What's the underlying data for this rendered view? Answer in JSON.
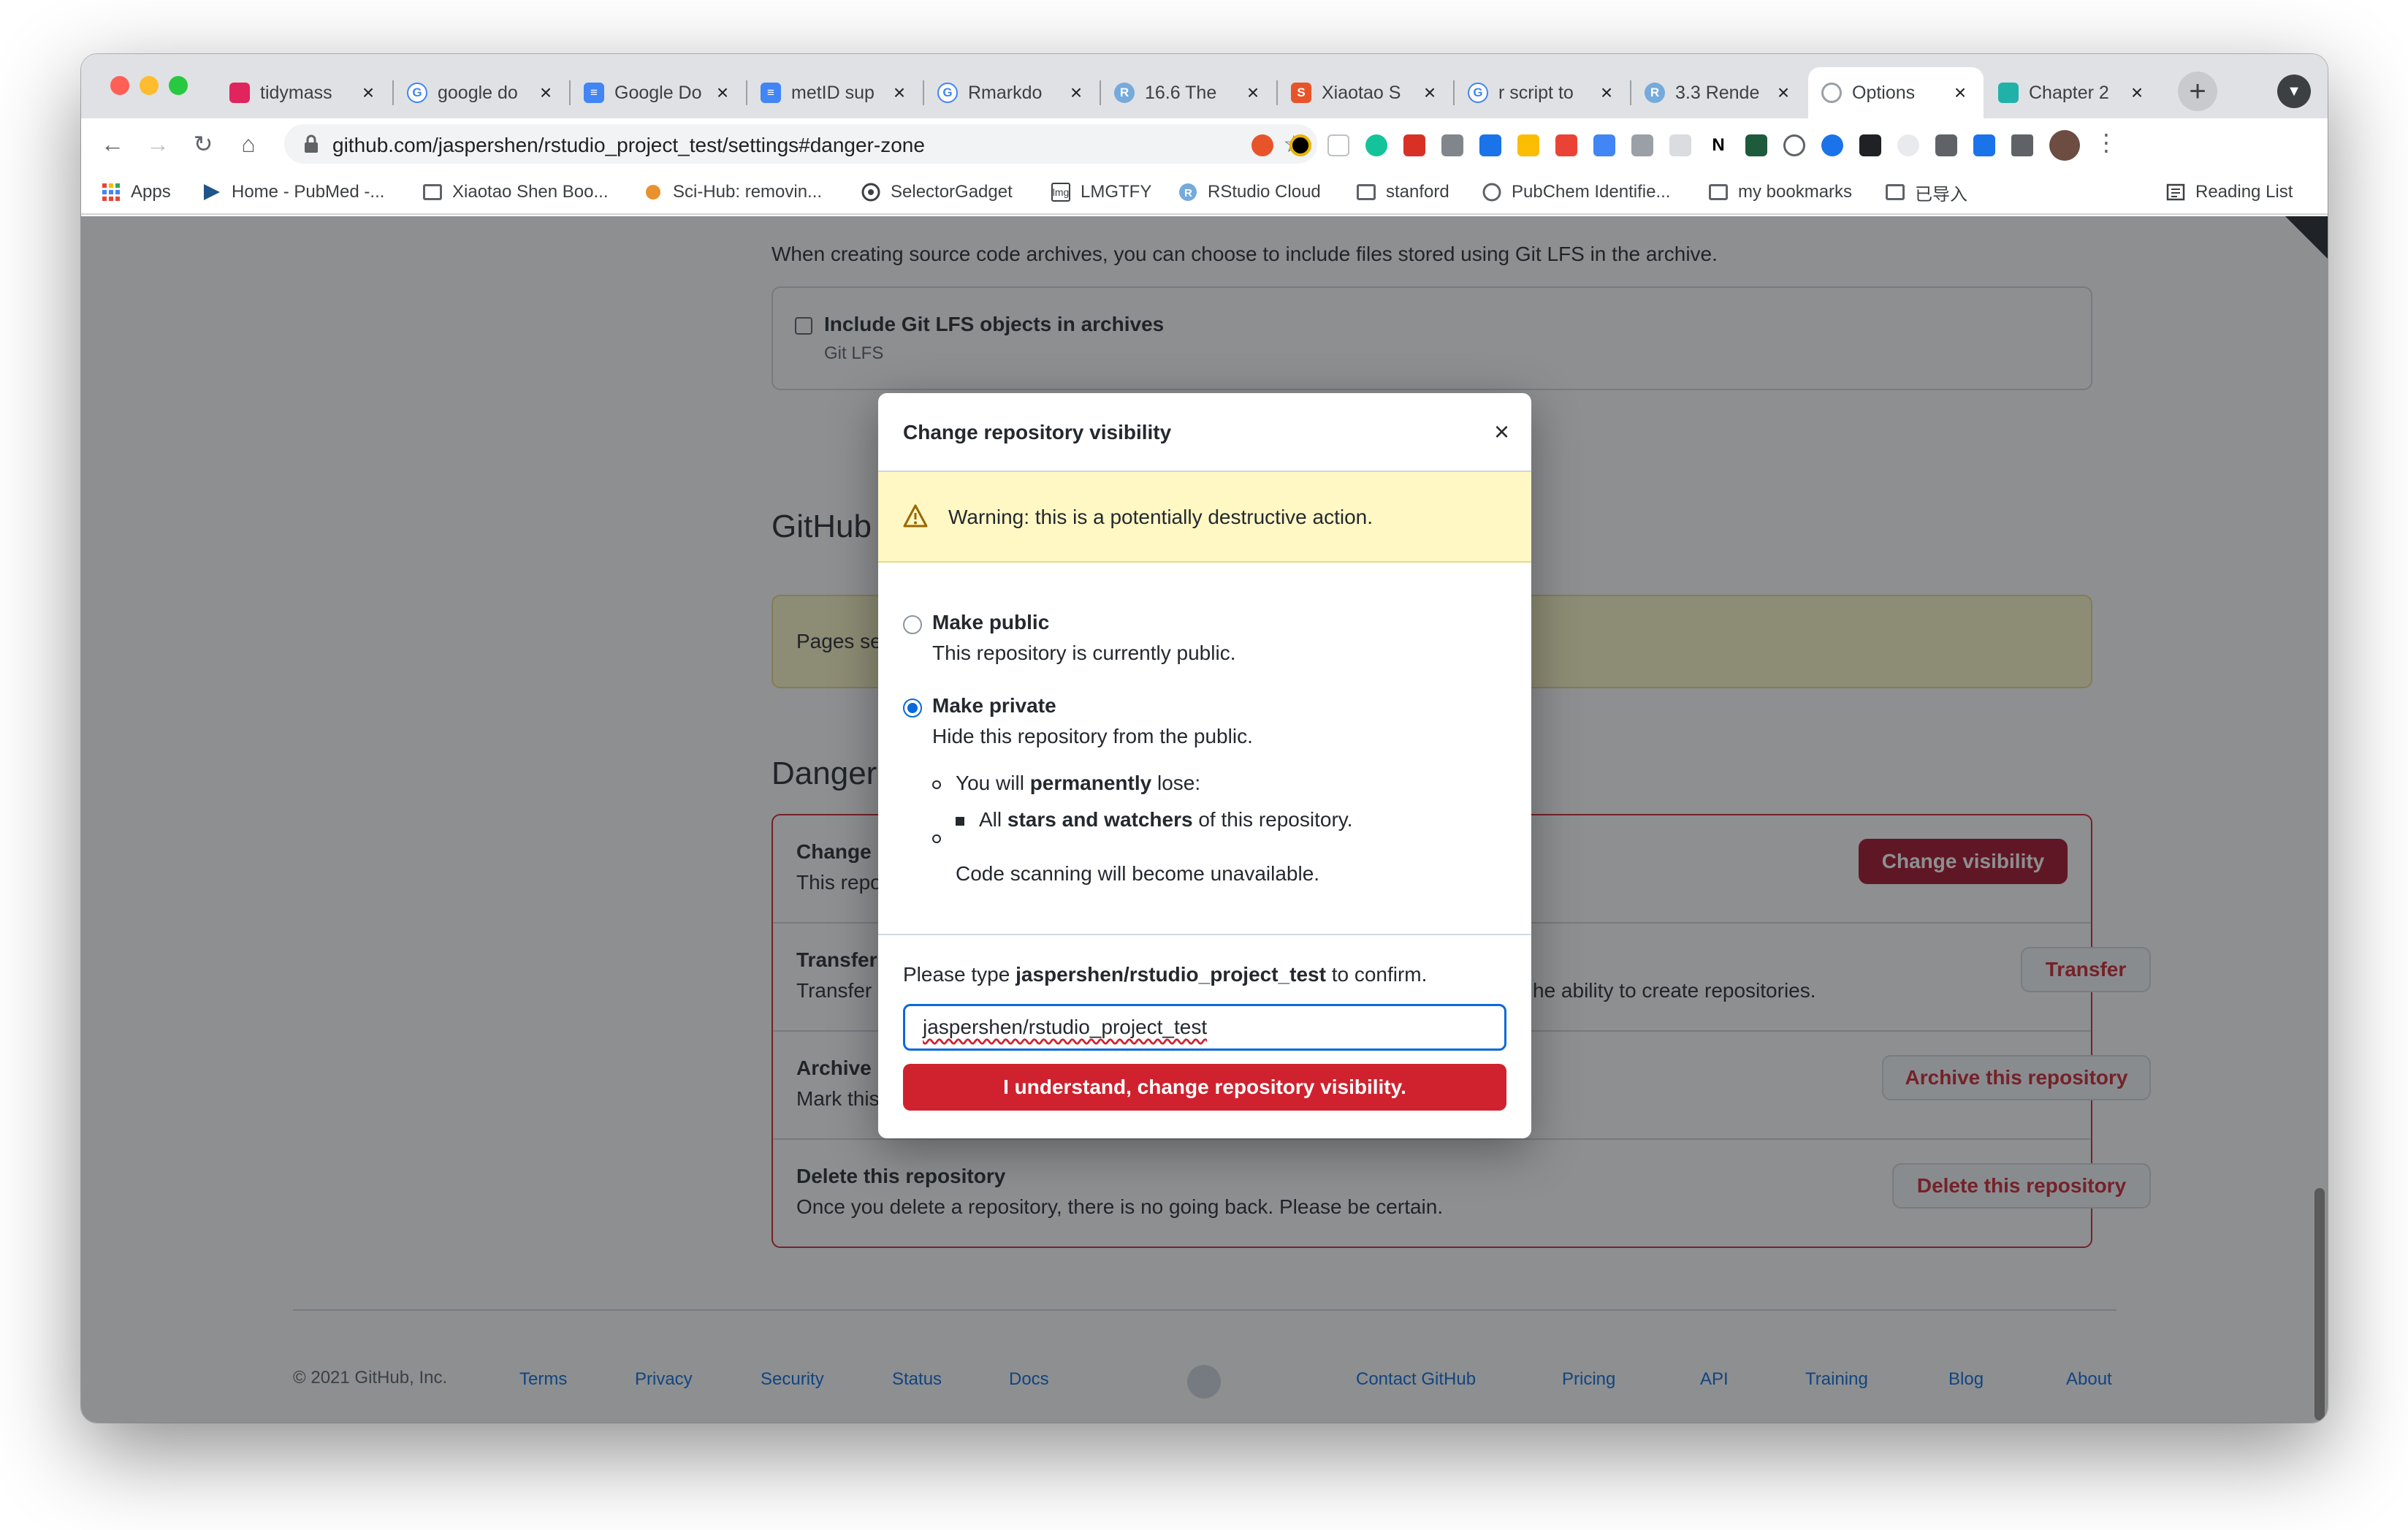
{
  "browser": {
    "tabs": [
      {
        "title": "tidymass",
        "color": "#e0245e"
      },
      {
        "title": "google do",
        "color": "#4285f4"
      },
      {
        "title": "Google Do",
        "color": "#4285f4"
      },
      {
        "title": "metID sup",
        "color": "#4285f4"
      },
      {
        "title": "Rmarkdo",
        "color": "#4285f4"
      },
      {
        "title": "16.6 The",
        "color": "#75aadb"
      },
      {
        "title": "Xiaotao S",
        "color": "#e8542a"
      },
      {
        "title": "r script to",
        "color": "#4285f4"
      },
      {
        "title": "3.3 Rende",
        "color": "#75aadb"
      },
      {
        "title": "Options",
        "color": "#24292f"
      },
      {
        "title": "Chapter 2",
        "color": "#20b2aa"
      }
    ],
    "active_tab_index": 9,
    "url": "github.com/jaspershen/rstudio_project_test/settings#danger-zone",
    "bookmarks": [
      {
        "label": "Apps",
        "icon": "apps-grid-icon"
      },
      {
        "label": "Home - PubMed -...",
        "icon": "pubmed-icon"
      },
      {
        "label": "Xiaotao Shen Boo...",
        "icon": "folder-icon"
      },
      {
        "label": "Sci-Hub: removin...",
        "icon": "scihub-icon"
      },
      {
        "label": "SelectorGadget",
        "icon": "selectorgadget-icon"
      },
      {
        "label": "LMGTFY",
        "icon": "lmgtfy-icon"
      },
      {
        "label": "RStudio Cloud",
        "icon": "rstudio-icon"
      },
      {
        "label": "stanford",
        "icon": "folder-icon"
      },
      {
        "label": "PubChem Identifie...",
        "icon": "pubchem-icon"
      },
      {
        "label": "my bookmarks",
        "icon": "folder-icon"
      },
      {
        "label": "已导入",
        "icon": "folder-icon"
      }
    ],
    "reading_list": "Reading List"
  },
  "page": {
    "lfs_description": "When creating source code archives, you can choose to include files stored using Git LFS in the archive.",
    "lfs_checkbox_label": "Include Git LFS objects in archives",
    "lfs_checkbox_sub": "Git LFS",
    "pages_heading": "GitHub",
    "pages_text": "Pages se",
    "danger_heading": "Danger",
    "rows": [
      {
        "title": "Change",
        "desc": "This repo",
        "button": "Change visibility"
      },
      {
        "title": "Transfer",
        "desc": "Transfer",
        "desc_tail": "he ability to create repositories.",
        "button": "Transfer"
      },
      {
        "title": "Archive",
        "desc": "Mark this",
        "button": "Archive this repository"
      },
      {
        "title": "Delete this repository",
        "desc": "Once you delete a repository, there is no going back. Please be certain.",
        "button": "Delete this repository"
      }
    ],
    "footer": {
      "copyright": "© 2021 GitHub, Inc.",
      "links_left": [
        "Terms",
        "Privacy",
        "Security",
        "Status",
        "Docs"
      ],
      "links_right": [
        "Contact GitHub",
        "Pricing",
        "API",
        "Training",
        "Blog",
        "About"
      ]
    }
  },
  "dialog": {
    "title": "Change repository visibility",
    "warning": "Warning: this is a potentially destructive action.",
    "public_label": "Make public",
    "public_desc": "This repository is currently public.",
    "private_label": "Make private",
    "private_desc": "Hide this repository from the public.",
    "lose_prefix": "You will ",
    "lose_bold": "permanently",
    "lose_suffix": " lose:",
    "stars_prefix": "All ",
    "stars_bold": "stars and watchers",
    "stars_suffix": " of this repository.",
    "code_scanning": "Code scanning will become unavailable.",
    "confirm_prefix": "Please type ",
    "confirm_repo": "jaspershen/rstudio_project_test",
    "confirm_suffix": " to confirm.",
    "input_value": "jaspershen/rstudio_project_test",
    "submit_label": "I understand, change repository visibility.",
    "selected_option": "Make private"
  }
}
